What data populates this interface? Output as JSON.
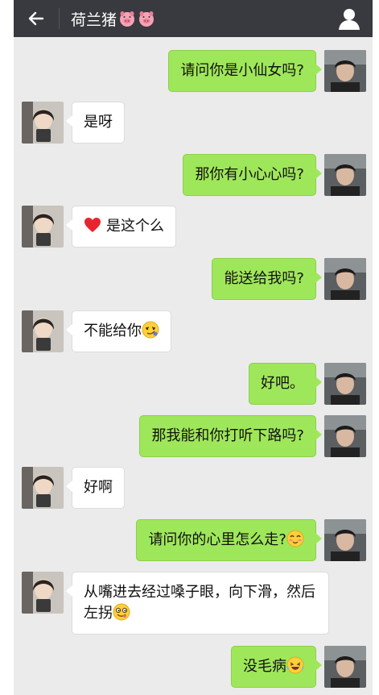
{
  "header": {
    "title": "荷兰猪",
    "back_icon": "back-arrow-icon",
    "title_icons": [
      "pig-face-icon",
      "pig-face-icon"
    ],
    "user_icon": "user-profile-icon"
  },
  "colors": {
    "header_bg": "#393a3f",
    "chat_bg": "#ebebeb",
    "sent_bubble": "#9fe75a",
    "received_bubble": "#ffffff"
  },
  "messages": [
    {
      "side": "right",
      "text": "请问你是小仙女吗?"
    },
    {
      "side": "left",
      "text": "是呀"
    },
    {
      "side": "right",
      "text": "那你有小心心吗?"
    },
    {
      "side": "left",
      "text": "是这个么",
      "icon": "red-heart-icon"
    },
    {
      "side": "right",
      "text": "能送给我吗?"
    },
    {
      "side": "left",
      "text": "不能给你",
      "emoji": "smirk-emoji-icon"
    },
    {
      "side": "right",
      "text": "好吧。"
    },
    {
      "side": "right",
      "text": "那我能和你打听下路吗?"
    },
    {
      "side": "left",
      "text": "好啊"
    },
    {
      "side": "right",
      "text": "请问你的心里怎么走?",
      "emoji": "blush-emoji-icon"
    },
    {
      "side": "left",
      "text": "从嘴进去经过嗓子眼，向下滑，然后左拐",
      "emoji": "tongue-out-emoji-icon"
    },
    {
      "side": "right",
      "text": "没毛病",
      "emoji": "laughing-emoji-icon"
    }
  ]
}
